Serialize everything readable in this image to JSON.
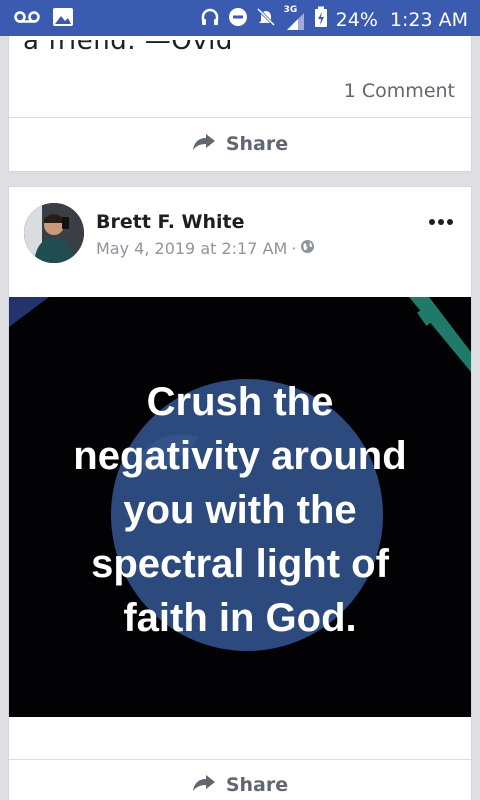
{
  "status_bar": {
    "battery": "24%",
    "time": "1:23 AM",
    "network": "3G"
  },
  "top_card": {
    "truncated_text": "a friend. —Ovid",
    "comment_count": "1 Comment",
    "share_label": "Share"
  },
  "post": {
    "author": "Brett F. White",
    "timestamp": "May 4, 2019 at 2:17 AM",
    "meta_separator": "·",
    "privacy_icon": "globe-icon",
    "image_text": {
      "line1": "Crush the",
      "line2": "negativity around",
      "line3": "you with the",
      "line4": "spectral light of",
      "line5": "faith in God."
    },
    "share_label": "Share"
  },
  "colors": {
    "status_bar": "#3b5bb0",
    "image_bg": "#020204",
    "orb": "#2d4a7f",
    "accent_stroke": "#1f7a6a"
  }
}
